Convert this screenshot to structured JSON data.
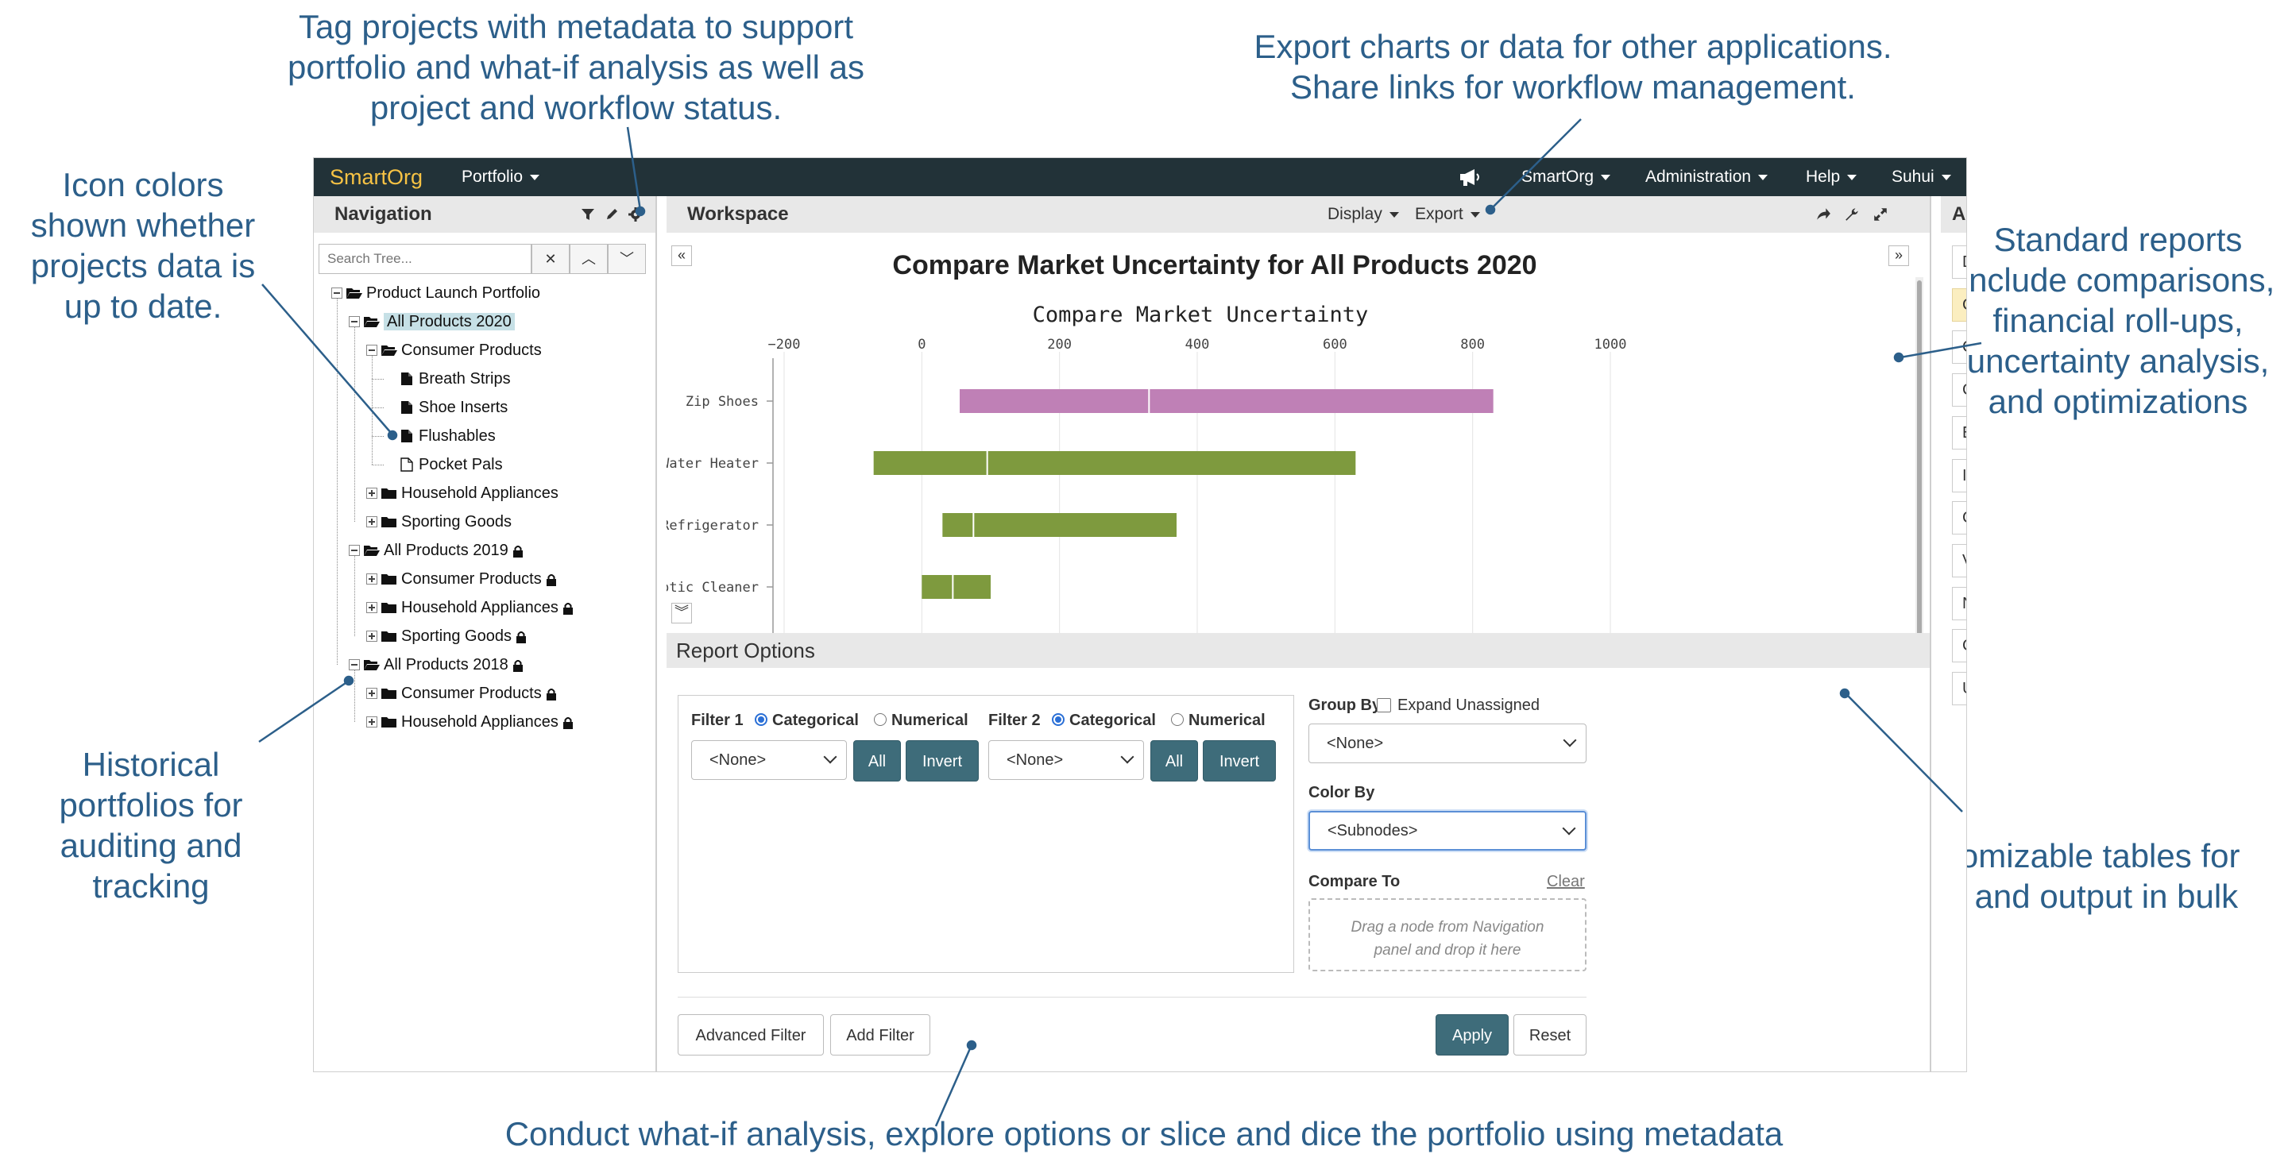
{
  "callouts": {
    "tag_projects": [
      "Tag projects with metadata to support",
      "portfolio and what-if analysis as well as",
      "project and workflow status."
    ],
    "export": [
      "Export charts or data for other applications.",
      "Share links for workflow management."
    ],
    "icon_colors": [
      "Icon colors",
      "shown whether",
      "projects data is",
      "up to date."
    ],
    "historical": [
      "Historical",
      "portfolios for",
      "auditing and",
      "tracking"
    ],
    "standard_reports": [
      "Standard reports",
      "include comparisons,",
      "financial roll-ups,",
      "uncertainty analysis,",
      "and optimizations"
    ],
    "customizable": [
      "Customizable tables for",
      "input and output in bulk"
    ],
    "whatif": [
      "Conduct what-if analysis, explore options or slice and dice the portfolio using metadata"
    ]
  },
  "navbar": {
    "brand": "SmartOrg",
    "portfolio_menu": "Portfolio",
    "smartorg_menu": "SmartOrg",
    "administration_menu": "Administration",
    "help_menu": "Help",
    "user_menu": "Suhui"
  },
  "navigation": {
    "title": "Navigation",
    "search_placeholder": "Search Tree...",
    "tree": [
      {
        "label": "Product Launch Portfolio",
        "level": 0,
        "kind": "folder-open",
        "toggle": "minus",
        "lock": false
      },
      {
        "label": "All Products 2020",
        "level": 1,
        "kind": "folder-open",
        "toggle": "minus",
        "lock": false,
        "selected": true
      },
      {
        "label": "Consumer Products",
        "level": 2,
        "kind": "folder-open",
        "toggle": "minus",
        "lock": false
      },
      {
        "label": "Breath Strips",
        "level": 3,
        "kind": "file",
        "lock": false
      },
      {
        "label": "Shoe Inserts",
        "level": 3,
        "kind": "file",
        "lock": false
      },
      {
        "label": "Flushables",
        "level": 3,
        "kind": "file",
        "lock": false
      },
      {
        "label": "Pocket Pals",
        "level": 3,
        "kind": "file-outline",
        "lock": false
      },
      {
        "label": "Household Appliances",
        "level": 2,
        "kind": "folder",
        "toggle": "plus",
        "lock": false
      },
      {
        "label": "Sporting Goods",
        "level": 2,
        "kind": "folder",
        "toggle": "plus",
        "lock": false
      },
      {
        "label": "All Products 2019",
        "level": 1,
        "kind": "folder-open",
        "toggle": "minus",
        "lock": true
      },
      {
        "label": "Consumer Products",
        "level": 2,
        "kind": "folder",
        "toggle": "plus",
        "lock": true
      },
      {
        "label": "Household Appliances",
        "level": 2,
        "kind": "folder",
        "toggle": "plus",
        "lock": true
      },
      {
        "label": "Sporting Goods",
        "level": 2,
        "kind": "folder",
        "toggle": "plus",
        "lock": true
      },
      {
        "label": "All Products 2018",
        "level": 1,
        "kind": "folder-open",
        "toggle": "minus",
        "lock": true
      },
      {
        "label": "Consumer Products",
        "level": 2,
        "kind": "folder",
        "toggle": "plus",
        "lock": true
      },
      {
        "label": "Household Appliances",
        "level": 2,
        "kind": "folder",
        "toggle": "plus",
        "lock": true
      }
    ]
  },
  "workspace": {
    "title": "Workspace",
    "display_menu": "Display",
    "export_menu": "Export"
  },
  "chart_data": {
    "type": "bar",
    "title": "Compare Market Uncertainty for All Products 2020",
    "subtitle": "Compare Market Uncertainty",
    "xlim": [
      -200,
      1000
    ],
    "xticks": [
      -200,
      0,
      200,
      400,
      600,
      800,
      1000
    ],
    "categories": [
      "Zip Shoes",
      "Water Heater",
      "Energy Efficient Refrigerator",
      "Robotic Cleaner"
    ],
    "low": [
      55,
      -70,
      30,
      0
    ],
    "base": [
      330,
      95,
      75,
      45
    ],
    "high": [
      830,
      630,
      370,
      100
    ],
    "colors": [
      "#bf80b6",
      "#7e9a3e",
      "#7e9a3e",
      "#7e9a3e"
    ]
  },
  "report_options": {
    "title": "Report Options",
    "filter1_label": "Filter 1",
    "filter2_label": "Filter 2",
    "categorical": "Categorical",
    "numerical": "Numerical",
    "none_option": "<None>",
    "all_button": "All",
    "invert_button": "Invert",
    "group_by_label": "Group By",
    "expand_unassigned": "Expand Unassigned",
    "group_by_value": "<None>",
    "color_by_label": "Color By",
    "color_by_value": "<Subnodes>",
    "compare_to_label": "Compare To",
    "clear_link": "Clear",
    "dropzone_line1": "Drag a node from Navigation",
    "dropzone_line2": "panel and drop it here",
    "advanced_filter": "Advanced Filter",
    "add_filter": "Add Filter",
    "apply": "Apply",
    "reset": "Reset"
  },
  "action": {
    "title": "Action",
    "items": [
      "Description",
      "Compare Market Uncertainty",
      "Compare Value",
      "Compare Dev Uncertainty",
      "Expected P&L",
      "Innovation Screen",
      "CFO Chart",
      "Value Profile",
      "NPV Full Distribution",
      "Common Data",
      "Universal Table"
    ],
    "highlighted": "Compare Market Uncertainty"
  },
  "colors": {
    "navbar_bg": "#223238",
    "brand": "#f6c244",
    "teal_button": "#3e6c7a",
    "callout_text": "#2c5f8a",
    "selected_tree": "#c6e0e6",
    "highlighted_action": "#fbeec0"
  }
}
